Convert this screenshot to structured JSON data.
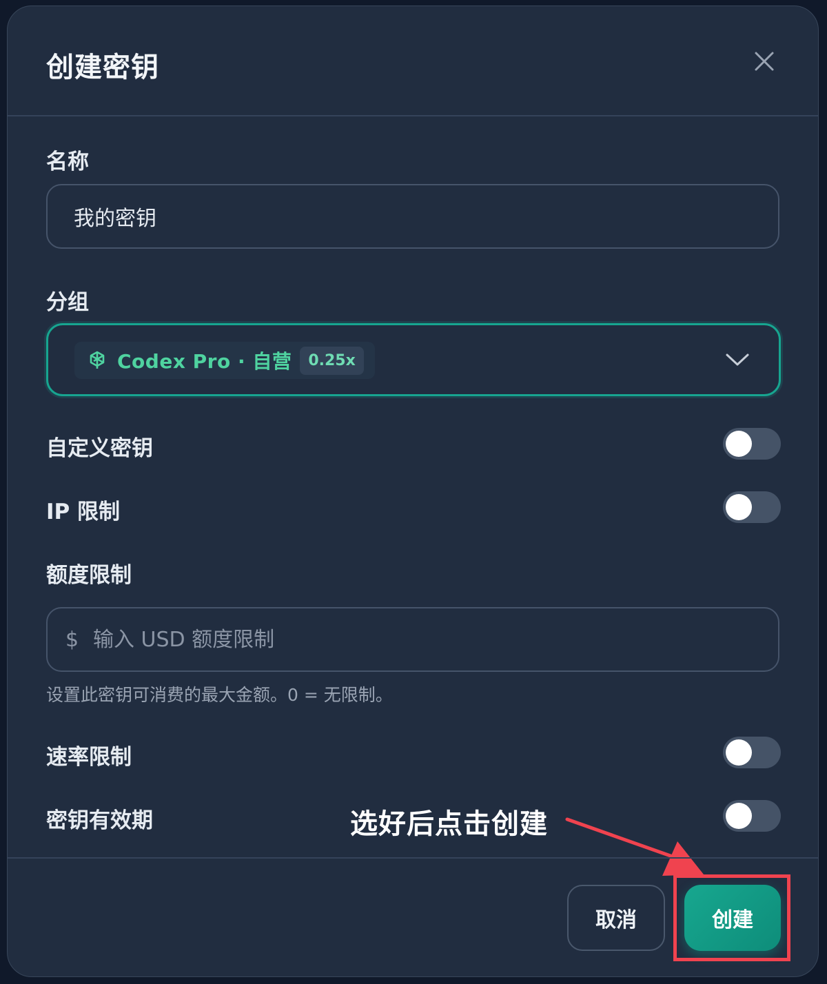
{
  "dialog": {
    "title": "创建密钥",
    "close_icon": "close-icon"
  },
  "name_field": {
    "label": "名称",
    "value": "我的密钥"
  },
  "group_field": {
    "label": "分组",
    "selected": {
      "icon": "openai-icon",
      "label": "Codex Pro · 自营",
      "rate": "0.25x"
    },
    "chevron_icon": "chevron-down-icon"
  },
  "toggles": {
    "custom_key": {
      "label": "自定义密钥",
      "enabled": false
    },
    "ip_limit": {
      "label": "IP 限制",
      "enabled": false
    },
    "rate_limit": {
      "label": "速率限制",
      "enabled": false
    },
    "expiry": {
      "label": "密钥有效期",
      "enabled": false
    }
  },
  "quota_field": {
    "label": "额度限制",
    "currency_symbol": "$",
    "placeholder": "输入 USD 额度限制",
    "hint": "设置此密钥可消费的最大金额。0 = 无限制。"
  },
  "annotation": {
    "text": "选好后点击创建",
    "color": "#f0434f"
  },
  "footer": {
    "cancel_label": "取消",
    "create_label": "创建"
  },
  "colors": {
    "accent": "#17a590",
    "background": "#212d40",
    "highlight": "#f0434f"
  }
}
